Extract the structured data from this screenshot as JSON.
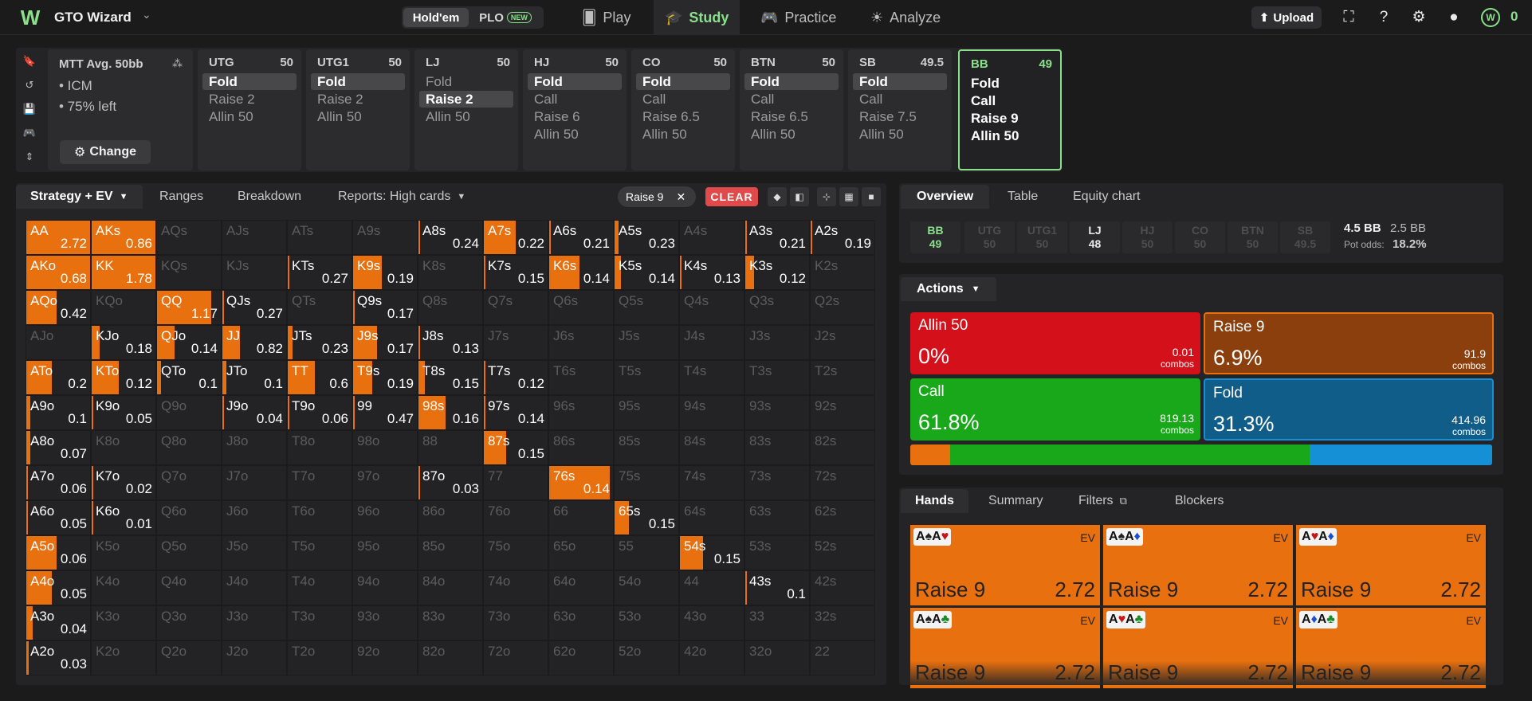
{
  "topbar": {
    "brand": "GTO Wizard",
    "game_holdem": "Hold'em",
    "game_plo": "PLO",
    "new_badge": "NEW",
    "nav": [
      {
        "label": "Play"
      },
      {
        "label": "Study"
      },
      {
        "label": "Practice"
      },
      {
        "label": "Analyze"
      }
    ],
    "upload": "Upload",
    "balance": "0"
  },
  "mtt": {
    "title": "MTT Avg. 50bb",
    "icm": "• ICM",
    "left": "• 75% left",
    "change": "Change"
  },
  "positions": [
    {
      "name": "UTG",
      "stack": "50",
      "actions": [
        "Fold",
        "Raise 2",
        "Allin 50"
      ],
      "selected": 0
    },
    {
      "name": "UTG1",
      "stack": "50",
      "actions": [
        "Fold",
        "Raise 2",
        "Allin 50"
      ],
      "selected": 0
    },
    {
      "name": "LJ",
      "stack": "50",
      "actions": [
        "Fold",
        "Raise 2",
        "Allin 50"
      ],
      "selected": 1
    },
    {
      "name": "HJ",
      "stack": "50",
      "actions": [
        "Fold",
        "Call",
        "Raise 6",
        "Allin 50"
      ],
      "selected": 0
    },
    {
      "name": "CO",
      "stack": "50",
      "actions": [
        "Fold",
        "Call",
        "Raise 6.5",
        "Allin 50"
      ],
      "selected": 0
    },
    {
      "name": "BTN",
      "stack": "50",
      "actions": [
        "Fold",
        "Call",
        "Raise 6.5",
        "Allin 50"
      ],
      "selected": 0
    },
    {
      "name": "SB",
      "stack": "49.5",
      "actions": [
        "Fold",
        "Call",
        "Raise 7.5",
        "Allin 50"
      ],
      "selected": 0
    },
    {
      "name": "BB",
      "stack": "49",
      "actions": [
        "Fold",
        "Call",
        "Raise 9",
        "Allin 50"
      ],
      "selected": -1
    }
  ],
  "grid_tabs": {
    "strategy": "Strategy + EV",
    "ranges": "Ranges",
    "breakdown": "Breakdown",
    "reports": "Reports: High cards"
  },
  "filter_chip": "Raise 9",
  "clear": "CLEAR",
  "grid": [
    [
      [
        "AA",
        "2.72",
        100
      ],
      [
        "AKs",
        "0.86",
        100
      ],
      [
        "AQs",
        "",
        0
      ],
      [
        "AJs",
        "",
        0
      ],
      [
        "ATs",
        "",
        0
      ],
      [
        "A9s",
        "",
        0
      ],
      [
        "A8s",
        "0.24",
        3
      ],
      [
        "A7s",
        "0.22",
        50
      ],
      [
        "A6s",
        "0.21",
        3
      ],
      [
        "A5s",
        "0.23",
        6
      ],
      [
        "A4s",
        "",
        0
      ],
      [
        "A3s",
        "0.21",
        2
      ],
      [
        "A2s",
        "0.19",
        2
      ]
    ],
    [
      [
        "AKo",
        "0.68",
        100
      ],
      [
        "KK",
        "1.78",
        100
      ],
      [
        "KQs",
        "",
        0
      ],
      [
        "KJs",
        "",
        0
      ],
      [
        "KTs",
        "0.27",
        2
      ],
      [
        "K9s",
        "0.19",
        45
      ],
      [
        "K8s",
        "",
        0
      ],
      [
        "K7s",
        "0.15",
        3
      ],
      [
        "K6s",
        "0.14",
        48
      ],
      [
        "K5s",
        "0.14",
        10
      ],
      [
        "K4s",
        "0.13",
        3
      ],
      [
        "K3s",
        "0.12",
        14
      ],
      [
        "K2s",
        "",
        0
      ]
    ],
    [
      [
        "AQo",
        "0.42",
        48
      ],
      [
        "KQo",
        "",
        0
      ],
      [
        "QQ",
        "1.17",
        85
      ],
      [
        "QJs",
        "0.27",
        2
      ],
      [
        "QTs",
        "",
        0
      ],
      [
        "Q9s",
        "0.17",
        2
      ],
      [
        "Q8s",
        "",
        0
      ],
      [
        "Q7s",
        "",
        0
      ],
      [
        "Q6s",
        "",
        0
      ],
      [
        "Q5s",
        "",
        0
      ],
      [
        "Q4s",
        "",
        0
      ],
      [
        "Q3s",
        "",
        0
      ],
      [
        "Q2s",
        "",
        0
      ]
    ],
    [
      [
        "AJo",
        "",
        0
      ],
      [
        "KJo",
        "0.18",
        12
      ],
      [
        "QJo",
        "0.14",
        28
      ],
      [
        "JJ",
        "0.82",
        28
      ],
      [
        "JTs",
        "0.23",
        8
      ],
      [
        "J9s",
        "0.17",
        38
      ],
      [
        "J8s",
        "0.13",
        3
      ],
      [
        "J7s",
        "",
        0
      ],
      [
        "J6s",
        "",
        0
      ],
      [
        "J5s",
        "",
        0
      ],
      [
        "J4s",
        "",
        0
      ],
      [
        "J3s",
        "",
        0
      ],
      [
        "J2s",
        "",
        0
      ]
    ],
    [
      [
        "ATo",
        "0.2",
        40
      ],
      [
        "KTo",
        "0.12",
        42
      ],
      [
        "QTo",
        "0.1",
        6
      ],
      [
        "JTo",
        "0.1",
        6
      ],
      [
        "TT",
        "0.6",
        42
      ],
      [
        "T9s",
        "0.19",
        30
      ],
      [
        "T8s",
        "0.15",
        10
      ],
      [
        "T7s",
        "0.12",
        3
      ],
      [
        "T6s",
        "",
        0
      ],
      [
        "T5s",
        "",
        0
      ],
      [
        "T4s",
        "",
        0
      ],
      [
        "T3s",
        "",
        0
      ],
      [
        "T2s",
        "",
        0
      ]
    ],
    [
      [
        "A9o",
        "0.1",
        6
      ],
      [
        "K9o",
        "0.05",
        3
      ],
      [
        "Q9o",
        "",
        0
      ],
      [
        "J9o",
        "0.04",
        3
      ],
      [
        "T9o",
        "0.06",
        3
      ],
      [
        "99",
        "0.47",
        3
      ],
      [
        "98s",
        "0.16",
        42
      ],
      [
        "97s",
        "0.14",
        3
      ],
      [
        "96s",
        "",
        0
      ],
      [
        "95s",
        "",
        0
      ],
      [
        "94s",
        "",
        0
      ],
      [
        "93s",
        "",
        0
      ],
      [
        "92s",
        "",
        0
      ]
    ],
    [
      [
        "A8o",
        "0.07",
        6
      ],
      [
        "K8o",
        "",
        0
      ],
      [
        "Q8o",
        "",
        0
      ],
      [
        "J8o",
        "",
        0
      ],
      [
        "T8o",
        "",
        0
      ],
      [
        "98o",
        "",
        0
      ],
      [
        "88",
        "",
        0
      ],
      [
        "87s",
        "0.15",
        35
      ],
      [
        "86s",
        "",
        0
      ],
      [
        "85s",
        "",
        0
      ],
      [
        "84s",
        "",
        0
      ],
      [
        "83s",
        "",
        0
      ],
      [
        "82s",
        "",
        0
      ]
    ],
    [
      [
        "A7o",
        "0.06",
        3
      ],
      [
        "K7o",
        "0.02",
        2
      ],
      [
        "Q7o",
        "",
        0
      ],
      [
        "J7o",
        "",
        0
      ],
      [
        "T7o",
        "",
        0
      ],
      [
        "97o",
        "",
        0
      ],
      [
        "87o",
        "0.03",
        3
      ],
      [
        "77",
        "",
        0
      ],
      [
        "76s",
        "0.14",
        95
      ],
      [
        "75s",
        "",
        0
      ],
      [
        "74s",
        "",
        0
      ],
      [
        "73s",
        "",
        0
      ],
      [
        "72s",
        "",
        0
      ]
    ],
    [
      [
        "A6o",
        "0.05",
        3
      ],
      [
        "K6o",
        "0.01",
        3
      ],
      [
        "Q6o",
        "",
        0
      ],
      [
        "J6o",
        "",
        0
      ],
      [
        "T6o",
        "",
        0
      ],
      [
        "96o",
        "",
        0
      ],
      [
        "86o",
        "",
        0
      ],
      [
        "76o",
        "",
        0
      ],
      [
        "66",
        "",
        0
      ],
      [
        "65s",
        "0.15",
        22
      ],
      [
        "64s",
        "",
        0
      ],
      [
        "63s",
        "",
        0
      ],
      [
        "62s",
        "",
        0
      ]
    ],
    [
      [
        "A5o",
        "0.06",
        48
      ],
      [
        "K5o",
        "",
        0
      ],
      [
        "Q5o",
        "",
        0
      ],
      [
        "J5o",
        "",
        0
      ],
      [
        "T5o",
        "",
        0
      ],
      [
        "95o",
        "",
        0
      ],
      [
        "85o",
        "",
        0
      ],
      [
        "75o",
        "",
        0
      ],
      [
        "65o",
        "",
        0
      ],
      [
        "55",
        "",
        0
      ],
      [
        "54s",
        "0.15",
        36
      ],
      [
        "53s",
        "",
        0
      ],
      [
        "52s",
        "",
        0
      ]
    ],
    [
      [
        "A4o",
        "0.05",
        40
      ],
      [
        "K4o",
        "",
        0
      ],
      [
        "Q4o",
        "",
        0
      ],
      [
        "J4o",
        "",
        0
      ],
      [
        "T4o",
        "",
        0
      ],
      [
        "94o",
        "",
        0
      ],
      [
        "84o",
        "",
        0
      ],
      [
        "74o",
        "",
        0
      ],
      [
        "64o",
        "",
        0
      ],
      [
        "54o",
        "",
        0
      ],
      [
        "44",
        "",
        0
      ],
      [
        "43s",
        "0.1",
        3
      ],
      [
        "42s",
        "",
        0
      ]
    ],
    [
      [
        "A3o",
        "0.04",
        10
      ],
      [
        "K3o",
        "",
        0
      ],
      [
        "Q3o",
        "",
        0
      ],
      [
        "J3o",
        "",
        0
      ],
      [
        "T3o",
        "",
        0
      ],
      [
        "93o",
        "",
        0
      ],
      [
        "83o",
        "",
        0
      ],
      [
        "73o",
        "",
        0
      ],
      [
        "63o",
        "",
        0
      ],
      [
        "53o",
        "",
        0
      ],
      [
        "43o",
        "",
        0
      ],
      [
        "33",
        "",
        0
      ],
      [
        "32s",
        "",
        0
      ]
    ],
    [
      [
        "A2o",
        "0.03",
        4
      ],
      [
        "K2o",
        "",
        0
      ],
      [
        "Q2o",
        "",
        0
      ],
      [
        "J2o",
        "",
        0
      ],
      [
        "T2o",
        "",
        0
      ],
      [
        "92o",
        "",
        0
      ],
      [
        "82o",
        "",
        0
      ],
      [
        "72o",
        "",
        0
      ],
      [
        "62o",
        "",
        0
      ],
      [
        "52o",
        "",
        0
      ],
      [
        "42o",
        "",
        0
      ],
      [
        "32o",
        "",
        0
      ],
      [
        "22",
        "",
        0
      ]
    ]
  ],
  "right_tabs": {
    "overview": "Overview",
    "table": "Table",
    "equity": "Equity chart"
  },
  "overview_positions": [
    {
      "name": "BB",
      "stack": "49"
    },
    {
      "name": "UTG",
      "stack": "50"
    },
    {
      "name": "UTG1",
      "stack": "50"
    },
    {
      "name": "LJ",
      "stack": "48"
    },
    {
      "name": "HJ",
      "stack": "50"
    },
    {
      "name": "CO",
      "stack": "50"
    },
    {
      "name": "BTN",
      "stack": "50"
    },
    {
      "name": "SB",
      "stack": "49.5"
    }
  ],
  "pot": {
    "bb": "4.5 BB",
    "bb2": "2.5 BB",
    "odds_label": "Pot odds:",
    "odds": "18.2%"
  },
  "actions_tab": "Actions",
  "actions": [
    {
      "name": "Allin 50",
      "pct": "0%",
      "combos": "0.01",
      "combos_label": "combos",
      "color": "#d4101a"
    },
    {
      "name": "Raise 9",
      "pct": "6.9%",
      "combos": "91.9",
      "combos_label": "combos",
      "color": "#8a3f0c"
    },
    {
      "name": "Call",
      "pct": "61.8%",
      "combos": "819.13",
      "combos_label": "combos",
      "color": "#18a81a"
    },
    {
      "name": "Fold",
      "pct": "31.3%",
      "combos": "414.96",
      "combos_label": "combos",
      "color": "#0f5d88"
    }
  ],
  "action_bar": [
    {
      "color": "#e8700f",
      "pct": 6.9
    },
    {
      "color": "#18a81a",
      "pct": 61.8
    },
    {
      "color": "#1590d6",
      "pct": 31.3
    }
  ],
  "hands_tabs": {
    "hands": "Hands",
    "summary": "Summary",
    "filters": "Filters",
    "blockers": "Blockers"
  },
  "hands": [
    {
      "c1": "A",
      "s1": "♠",
      "c2": "A",
      "s2": "♥",
      "ev": "EV",
      "action": "Raise 9",
      "value": "2.72"
    },
    {
      "c1": "A",
      "s1": "♠",
      "c2": "A",
      "s2": "♦",
      "ev": "EV",
      "action": "Raise 9",
      "value": "2.72"
    },
    {
      "c1": "A",
      "s1": "♥",
      "c2": "A",
      "s2": "♦",
      "ev": "EV",
      "action": "Raise 9",
      "value": "2.72"
    },
    {
      "c1": "A",
      "s1": "♠",
      "c2": "A",
      "s2": "♣",
      "ev": "EV",
      "action": "Raise 9",
      "value": "2.72"
    },
    {
      "c1": "A",
      "s1": "♥",
      "c2": "A",
      "s2": "♣",
      "ev": "EV",
      "action": "Raise 9",
      "value": "2.72"
    },
    {
      "c1": "A",
      "s1": "♦",
      "c2": "A",
      "s2": "♣",
      "ev": "EV",
      "action": "Raise 9",
      "value": "2.72"
    }
  ]
}
